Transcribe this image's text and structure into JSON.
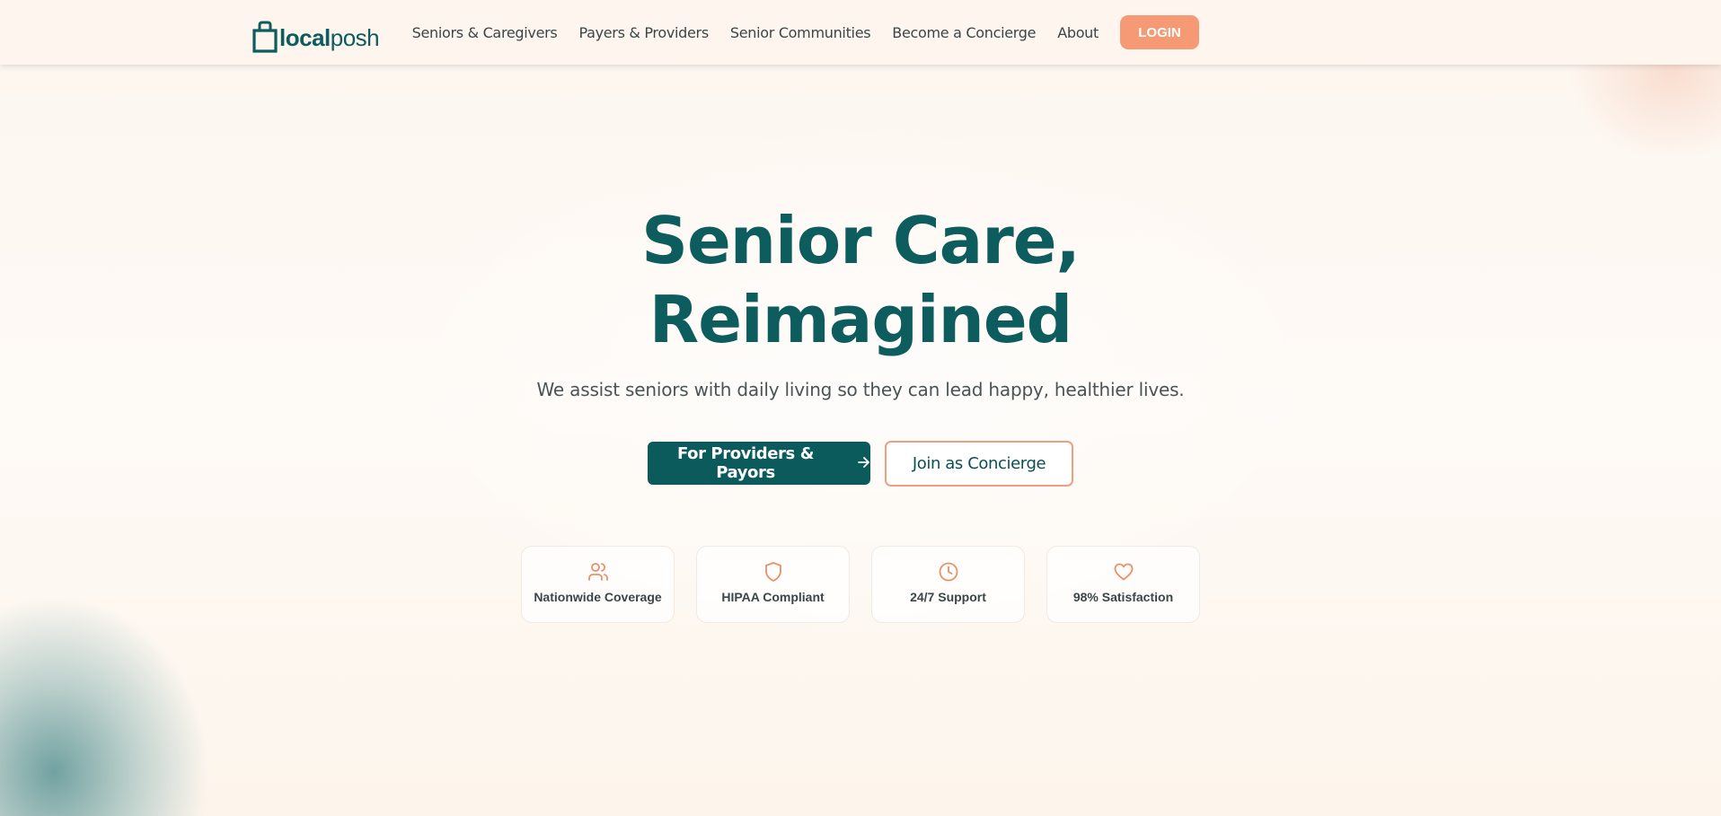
{
  "brand": {
    "logo_part1": "local",
    "logo_part2": "posh",
    "colors": {
      "primary": "#0d5c5e",
      "accent": "#f59a74",
      "icon_accent": "#e8906a"
    }
  },
  "nav": {
    "items": [
      {
        "label": "Seniors & Caregivers"
      },
      {
        "label": "Payers & Providers"
      },
      {
        "label": "Senior Communities"
      },
      {
        "label": "Become a Concierge"
      },
      {
        "label": "About"
      }
    ],
    "login_label": "LOGIN"
  },
  "hero": {
    "headline_line1": "Senior Care,",
    "headline_line2": "Reimagined",
    "subtitle": "We assist seniors with daily living so they can lead happy, healthier lives.",
    "primary_cta": "For Providers & Payors",
    "primary_cta_icon": "arrow-right-icon",
    "secondary_cta": "Join as Concierge"
  },
  "features": [
    {
      "icon": "users-icon",
      "label": "Nationwide Coverage"
    },
    {
      "icon": "shield-icon",
      "label": "HIPAA Compliant"
    },
    {
      "icon": "clock-icon",
      "label": "24/7 Support"
    },
    {
      "icon": "heart-icon",
      "label": "98% Satisfaction"
    }
  ]
}
